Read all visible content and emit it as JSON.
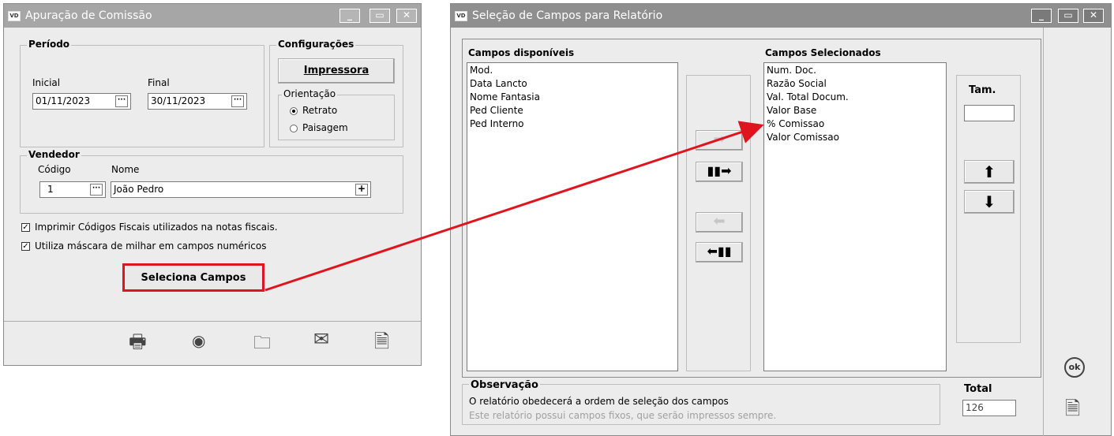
{
  "left_window": {
    "title": "Apuração de Comissão",
    "periodo": {
      "title": "Período",
      "inicial_label": "Inicial",
      "inicial_value": "01/11/2023",
      "final_label": "Final",
      "final_value": "30/11/2023"
    },
    "config": {
      "title": "Configurações",
      "impressora_label": "Impressora",
      "orientacao_label": "Orientação",
      "retrato_label": "Retrato",
      "paisagem_label": "Paisagem",
      "selected": "Retrato"
    },
    "vendedor": {
      "title": "Vendedor",
      "codigo_label": "Código",
      "nome_label": "Nome",
      "codigo_value": "1",
      "nome_value": "João Pedro"
    },
    "checkboxes": [
      {
        "label": "Imprimir Códigos Fiscais utilizados na notas fiscais.",
        "checked": true
      },
      {
        "label": "Utiliza máscara de milhar em campos numéricos",
        "checked": true
      }
    ],
    "seleciona_label": "Seleciona Campos",
    "toolbar_icons": [
      "printer-icon",
      "eye-icon",
      "folder-icon",
      "envelope-icon",
      "close-document-icon"
    ]
  },
  "right_window": {
    "title": "Seleção de Campos para Relatório",
    "disponiveis": {
      "title": "Campos disponíveis",
      "items": [
        "Mod.",
        "Data Lancto",
        "Nome Fantasia",
        "Ped Cliente",
        "Ped Interno"
      ]
    },
    "selecionados": {
      "title": "Campos Selecionados",
      "items": [
        "Num. Doc.",
        "Razão Social",
        "Val. Total Docum.",
        "Valor Base",
        "% Comissao",
        "Valor Comissao"
      ]
    },
    "tam_label": "Tam.",
    "tam_value": "",
    "observacao": {
      "title": "Observação",
      "line1": "O relatório obedecerá a ordem de seleção dos campos",
      "line2": "Este relatório possui campos fixos, que serão impressos sempre."
    },
    "total_label": "Total",
    "total_value": "126",
    "ok_label": "ok"
  },
  "colors": {
    "titlebar": "#a6a6a6",
    "window_bg": "#ececec",
    "highlight_red": "#e0141e"
  }
}
